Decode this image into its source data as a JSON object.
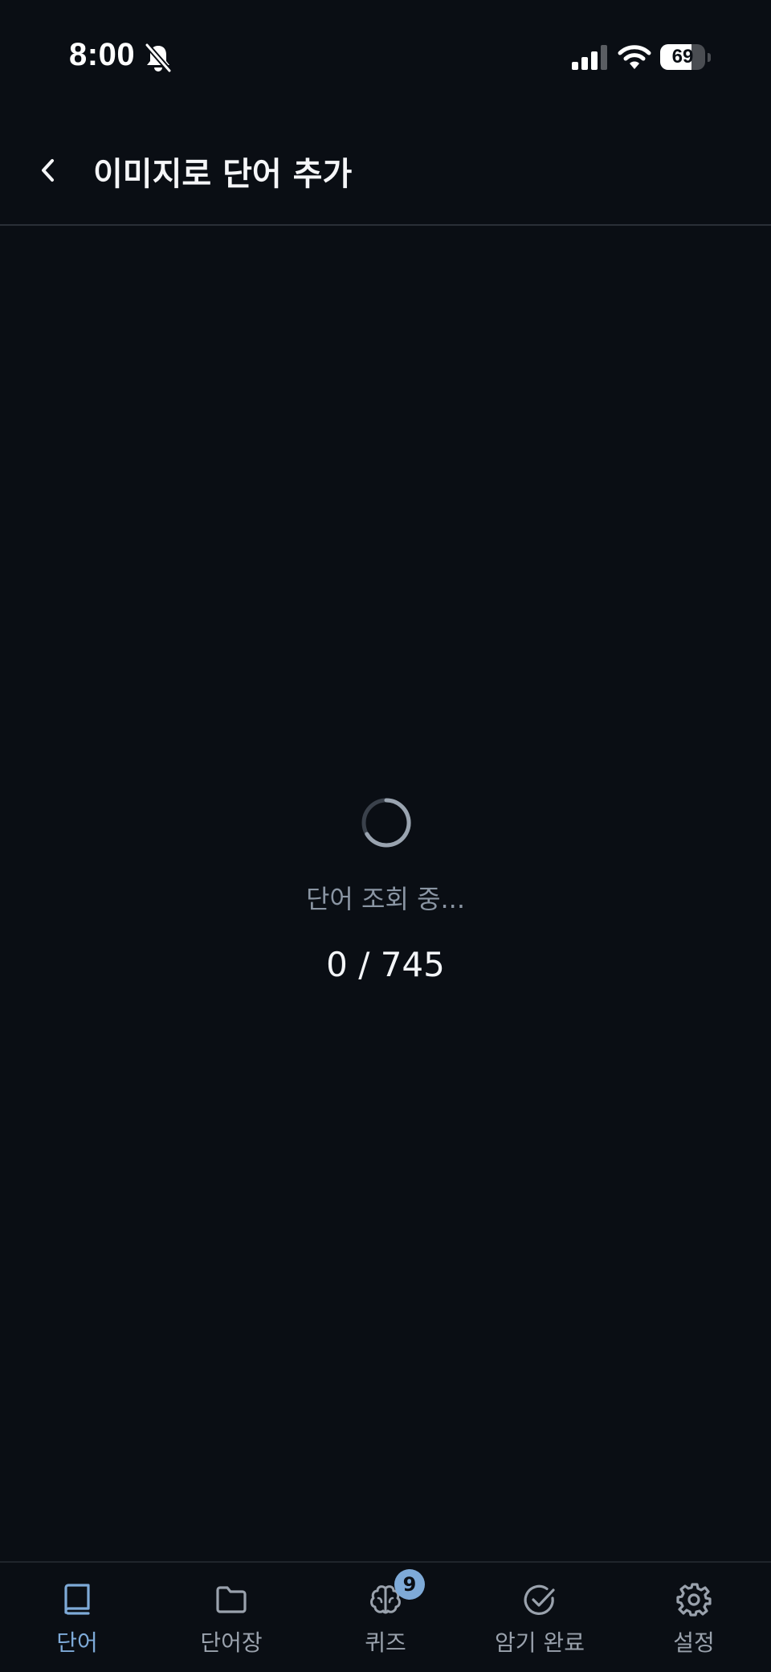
{
  "status_bar": {
    "time": "8:00",
    "battery_level": "69",
    "battery_fraction": 0.69,
    "icons": [
      "bell-slash-icon",
      "cellular-signal-icon",
      "wifi-icon",
      "battery-icon"
    ]
  },
  "header": {
    "title": "이미지로 단어 추가",
    "back_icon": "chevron-left-icon"
  },
  "loading": {
    "message": "단어 조회 중...",
    "progress_text": "0 / 745",
    "current": 0,
    "total": 745
  },
  "tabs": [
    {
      "label": "단어",
      "icon": "book-icon",
      "active": true
    },
    {
      "label": "단어장",
      "icon": "folder-icon",
      "active": false
    },
    {
      "label": "퀴즈",
      "icon": "brain-icon",
      "active": false,
      "badge": "9"
    },
    {
      "label": "암기 완료",
      "icon": "check-circle-icon",
      "active": false
    },
    {
      "label": "설정",
      "icon": "gear-icon",
      "active": false
    }
  ],
  "colors": {
    "background": "#0a0e14",
    "accent": "#7eaad8",
    "muted_text": "#8a95a3",
    "inactive_icon": "#9aa2ad"
  }
}
